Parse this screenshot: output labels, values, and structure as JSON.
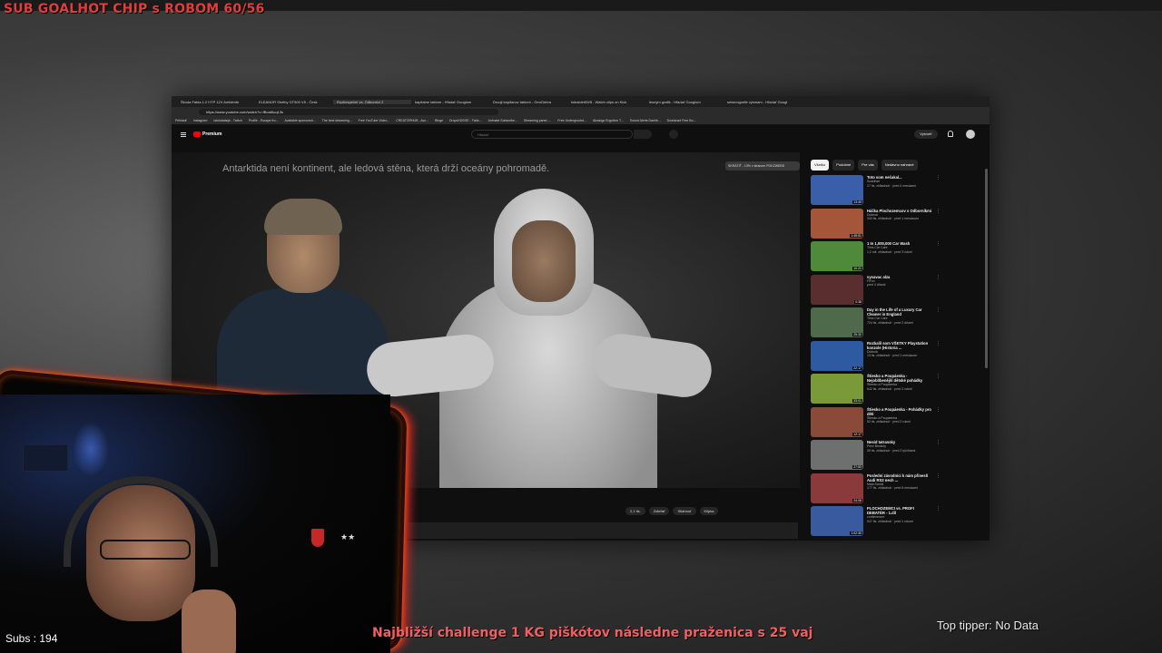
{
  "overlay": {
    "sub_goal": "SUB GOALHOT CHIP s ROBOM 60/56",
    "subs": "Subs : 194",
    "ticker": "Najbližší challenge 1 KG piškótov následne praženica s 25 vaj",
    "top_tipper": "Top tipper: No Data"
  },
  "browser": {
    "tabs": [
      "Škoda Fabia 1.2 HTP 12V Ambiente",
      "ELEANOR Shelby GT500 V8 - Česk",
      "Rozbezpeční vs. Odborníci 2",
      "kapitaine taktom - Hľadať Googlom",
      "Druuji kapitanov taktom - GeoGebra",
      "IsleaiderBVB - Watch clips on Kick",
      "lesným grafik - Hľadať Googlom",
      "seismografie výsmam - Hľadať Googl"
    ],
    "url": "https://www.youtube.com/watch?v=fBoa6Iuq13s",
    "bookmarks": [
      "Prihlásiť",
      "Instagram",
      "Istuiobatsyk - Twitch",
      "Profile - Escape fro...",
      "Available sponsorsh...",
      "The best streaming...",
      "Free YouTube Video...",
      "CREATORHUB - Acc...",
      "Binge",
      "DropsXDSGE - Twitc...",
      "Animate Subscribe...",
      "Streaming panel -...",
      "Free Undergroubd...",
      "Alzalogo ErgoArm T...",
      "Sound Alerts Dashb...",
      "Download Free Bo..."
    ]
  },
  "youtube": {
    "logo": "Premium",
    "search_placeholder": "Hľadať",
    "create_label": "Vytvoriť",
    "caption": "Antarktida není kontinent, ale ledová stěna, která drží oceány pohromadě.",
    "skip_chip": "SKRÁTIŤ - 13% v stranom POKZWEBS",
    "actions": {
      "likes": "2,1 tis.",
      "share": "Zdieľať",
      "download": "Stiahnuť",
      "clip": "Klipka"
    },
    "chips": [
      "Všetko",
      "Podobné",
      "Pre vás",
      "Nedávno nahrané"
    ],
    "recommendations": [
      {
        "title": "Toto som nečakal...",
        "channel": "Suskihse",
        "meta": "17 tis. zhliadnutí · pred 4 mesiacmi",
        "duration": "13:49",
        "color": "#3b5ea8"
      },
      {
        "title": "Háčka Plochozemcov s Odborníkmi",
        "channel": "Dubnok",
        "meta": "343 tis. zhliadnutí · pred 1 mesiacom",
        "duration": "1:45:51",
        "color": "#a5563a"
      },
      {
        "title": "1 In 1,000,000 Car Wash",
        "channel": "Tims Car Care",
        "meta": "1,2 mil. zhliadnutí · pred 3 rokmi",
        "duration": "10:21",
        "color": "#4e8a3a"
      },
      {
        "title": "vysavac alza",
        "channel": "FiFov",
        "meta": "pred 4 dňami",
        "duration": "0:38",
        "color": "#5a2e2e"
      },
      {
        "title": "Day in the Life of a Luxury Car Cleaner in England",
        "channel": "Tims Car Care",
        "meta": "724 tis. zhliadnutí · pred 2 dňami",
        "duration": "25:30",
        "color": "#4e6a4a"
      },
      {
        "title": "Rozbalil som VŠETKY Playstation konzole (Historia ...",
        "channel": "Dubnok",
        "meta": "13 tis. zhliadnutí · pred 1 mesiacom",
        "duration": "22:17",
        "color": "#2d5aa0"
      },
      {
        "title": "Štiesko a Poupáenka - Nejoblíbenější dětské pohádky",
        "channel": "Štiesko a Poupáenka",
        "meta": "642 tis. zhliadnutí · pred 2 rokmi",
        "duration": "33:01",
        "color": "#7a9a3a"
      },
      {
        "title": "Štiesko a Poupáenka - Pohádky pro děti",
        "channel": "Štiesko a Poupáenka",
        "meta": "52 tis. zhliadnutí · pred 2 rokmi",
        "duration": "12:17",
        "color": "#8a4a3a"
      },
      {
        "title": "Nesíd tatransky",
        "channel": "Pieni Beskidy",
        "meta": "39 tis. zhliadnutí · pred 2 týždňami",
        "duration": "27:53",
        "color": "#6e7070"
      },
      {
        "title": "Poslední závodníci k nám přineslí Audi RS3 nech ...",
        "channel": "Mala Šaulíž",
        "meta": "177 tis. zhliadnutí · pred 8 mesiacmi",
        "duration": "24:08",
        "color": "#8a3a3a"
      },
      {
        "title": "PLOCHOZEMCI vs. PROFI DEBATÉR - 1.díl",
        "channel": "confirmmore",
        "meta": "547 tis. zhliadnutí · pred 1 rokom",
        "duration": "1:02:30",
        "color": "#3a5aa0"
      }
    ]
  },
  "colors": {
    "sub_goal": "#e23d3d",
    "ticker": "#f06060",
    "frame_glow": "#ff6a00",
    "yt_red": "#ff0000"
  }
}
